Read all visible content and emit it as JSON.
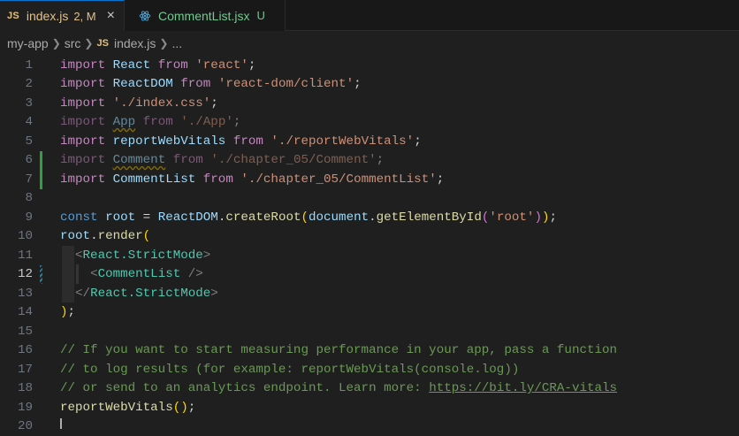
{
  "tabs": [
    {
      "badge": "JS",
      "name": "index.js",
      "status": "2, M",
      "close": "×"
    },
    {
      "name": "CommentList.jsx",
      "status": "U"
    }
  ],
  "breadcrumb": {
    "items": [
      "my-app",
      "src"
    ],
    "file_badge": "JS",
    "file": "index.js",
    "more": "..."
  },
  "line_numbers": [
    "1",
    "2",
    "3",
    "4",
    "5",
    "6",
    "7",
    "8",
    "9",
    "10",
    "11",
    "12",
    "13",
    "14",
    "15",
    "16",
    "17",
    "18",
    "19",
    "20"
  ],
  "code": {
    "l1": {
      "a": "import",
      "b": "React",
      "c": "from",
      "d": "'react'",
      "e": ";"
    },
    "l2": {
      "a": "import",
      "b": "ReactDOM",
      "c": "from",
      "d": "'react-dom/client'",
      "e": ";"
    },
    "l3": {
      "a": "import",
      "d": "'./index.css'",
      "e": ";"
    },
    "l4": {
      "a": "import",
      "b": "App",
      "c": "from",
      "d": "'./App'",
      "e": ";"
    },
    "l5": {
      "a": "import",
      "b": "reportWebVitals",
      "c": "from",
      "d": "'./reportWebVitals'",
      "e": ";"
    },
    "l6": {
      "a": "import",
      "b": "Comment",
      "c": "from",
      "d": "'./chapter_05/Comment'",
      "e": ";"
    },
    "l7": {
      "a": "import",
      "b": "CommentList",
      "c": "from",
      "d": "'./chapter_05/CommentList'",
      "e": ";"
    },
    "l9": {
      "a": "const",
      "b": "root",
      "eq": " = ",
      "c": "ReactDOM",
      "dot": ".",
      "d": "createRoot",
      "p1": "(",
      "e": "document",
      "dot2": ".",
      "f": "getElementById",
      "p2": "(",
      "g": "'root'",
      "p3": ")",
      "p4": ")",
      "semi": ";"
    },
    "l10": {
      "a": "root",
      "dot": ".",
      "b": "render",
      "p": "("
    },
    "l11": {
      "lt": "<",
      "tag": "React.StrictMode",
      "gt": ">"
    },
    "l12": {
      "lt": "<",
      "tag": "CommentList",
      "end": " />"
    },
    "l13": {
      "lt": "</",
      "tag": "React.StrictMode",
      "gt": ">"
    },
    "l14": {
      "p": ")",
      "semi": ";"
    },
    "l16": "// If you want to start measuring performance in your app, pass a function",
    "l17": "// to log results (for example: reportWebVitals(console.log))",
    "l18": {
      "text": "// or send to an analytics endpoint. Learn more: ",
      "link": "https://bit.ly/CRA-vitals"
    },
    "l19": {
      "a": "reportWebVitals",
      "p": "()",
      "semi": ";"
    }
  }
}
